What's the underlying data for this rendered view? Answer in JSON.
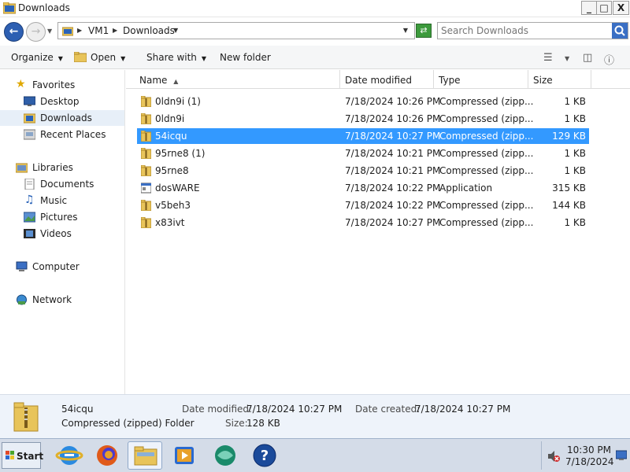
{
  "window": {
    "title": "Downloads"
  },
  "window_controls": {
    "minimize": "_",
    "maximize": "□",
    "close": "X"
  },
  "address": {
    "crumbs": [
      "VM1",
      "Downloads"
    ],
    "search_placeholder": "Search Downloads"
  },
  "toolbar": {
    "organize": "Organize",
    "open": "Open",
    "share_with": "Share with",
    "new_folder": "New folder"
  },
  "nav": {
    "favorites": "Favorites",
    "desktop": "Desktop",
    "downloads": "Downloads",
    "recent_places": "Recent Places",
    "libraries": "Libraries",
    "documents": "Documents",
    "music": "Music",
    "pictures": "Pictures",
    "videos": "Videos",
    "computer": "Computer",
    "network": "Network"
  },
  "columns": {
    "name": "Name",
    "date_modified": "Date modified",
    "type": "Type",
    "size": "Size"
  },
  "files": [
    {
      "name": "0ldn9i (1)",
      "date": "7/18/2024 10:26 PM",
      "type": "Compressed (zipp...",
      "size": "1 KB",
      "icon": "zip-folder-icon"
    },
    {
      "name": "0ldn9i",
      "date": "7/18/2024 10:26 PM",
      "type": "Compressed (zipp...",
      "size": "1 KB",
      "icon": "zip-folder-icon"
    },
    {
      "name": "54icqu",
      "date": "7/18/2024 10:27 PM",
      "type": "Compressed (zipp...",
      "size": "129 KB",
      "icon": "zip-folder-icon"
    },
    {
      "name": "95rne8 (1)",
      "date": "7/18/2024 10:21 PM",
      "type": "Compressed (zipp...",
      "size": "1 KB",
      "icon": "zip-folder-icon"
    },
    {
      "name": "95rne8",
      "date": "7/18/2024 10:21 PM",
      "type": "Compressed (zipp...",
      "size": "1 KB",
      "icon": "zip-folder-icon"
    },
    {
      "name": "dosWARE",
      "date": "7/18/2024 10:22 PM",
      "type": "Application",
      "size": "315 KB",
      "icon": "application-icon"
    },
    {
      "name": "v5beh3",
      "date": "7/18/2024 10:22 PM",
      "type": "Compressed (zipp...",
      "size": "144 KB",
      "icon": "zip-folder-icon"
    },
    {
      "name": "x83ivt",
      "date": "7/18/2024 10:27 PM",
      "type": "Compressed (zipp...",
      "size": "1 KB",
      "icon": "zip-folder-icon"
    }
  ],
  "selected_index": 2,
  "details": {
    "name": "54icqu",
    "type": "Compressed (zipped) Folder",
    "date_modified_label": "Date modified:",
    "date_modified": "7/18/2024 10:27 PM",
    "date_created_label": "Date created:",
    "date_created": "7/18/2024 10:27 PM",
    "size_label": "Size:",
    "size": "128 KB"
  },
  "taskbar": {
    "start_label": "Start",
    "apps": [
      "internet-explorer-icon",
      "firefox-icon",
      "windows-explorer-icon",
      "media-player-icon",
      "chat-icon",
      "help-icon"
    ],
    "time": "10:30 PM",
    "date": "7/18/2024"
  },
  "colors": {
    "selection": "#3399ff",
    "nav_selected": "#e7eff8",
    "details_bg": "#eef3fa",
    "taskbar_bg": "#d4dce8"
  }
}
